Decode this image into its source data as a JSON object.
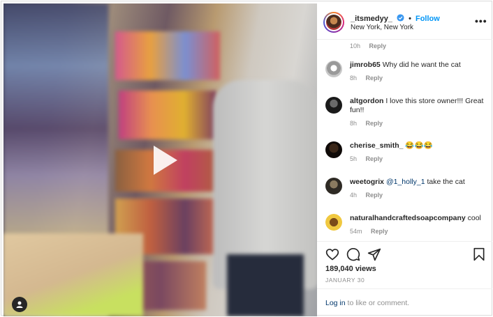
{
  "post": {
    "username": "_itsmedyy_",
    "follow_label": "Follow",
    "separator": "•",
    "location": "New York, New York",
    "more_label": "•••"
  },
  "first_comment_meta": {
    "time": "10h",
    "reply": "Reply"
  },
  "comments": [
    {
      "username": "jimrob65",
      "text": "Why did he want the cat",
      "time": "8h",
      "reply": "Reply",
      "avatar_color": "#b8b8b8"
    },
    {
      "username": "altgordon",
      "text": "I love this store owner!!! Great fun!!",
      "time": "8h",
      "reply": "Reply",
      "avatar_color": "#2a2a2a"
    },
    {
      "username": "cherise_smith_",
      "text": "😂😂😂",
      "time": "5h",
      "reply": "Reply",
      "avatar_color": "#1c1410"
    },
    {
      "username": "weetogrix",
      "mention": "@1_holly_1",
      "text": " take the cat",
      "time": "4h",
      "reply": "Reply",
      "avatar_color": "#3d3a34"
    },
    {
      "username": "naturalhandcraftedsoapcompany",
      "text": "cool",
      "time": "54m",
      "reply": "Reply",
      "avatar_color": "#e8c23a"
    }
  ],
  "stats": {
    "views": "189,040 views",
    "date": "JANUARY 30"
  },
  "footer": {
    "login_link": "Log in",
    "login_rest": " to like or comment."
  },
  "icons": {
    "like": "heart-icon",
    "comment": "comment-icon",
    "share": "paper-plane-icon",
    "save": "bookmark-icon",
    "play": "play-icon",
    "tag": "user-tag-icon",
    "verified": "verified-badge-icon"
  },
  "colors": {
    "accent": "#0095f6",
    "link": "#00376b",
    "muted": "#8e8e8e"
  }
}
